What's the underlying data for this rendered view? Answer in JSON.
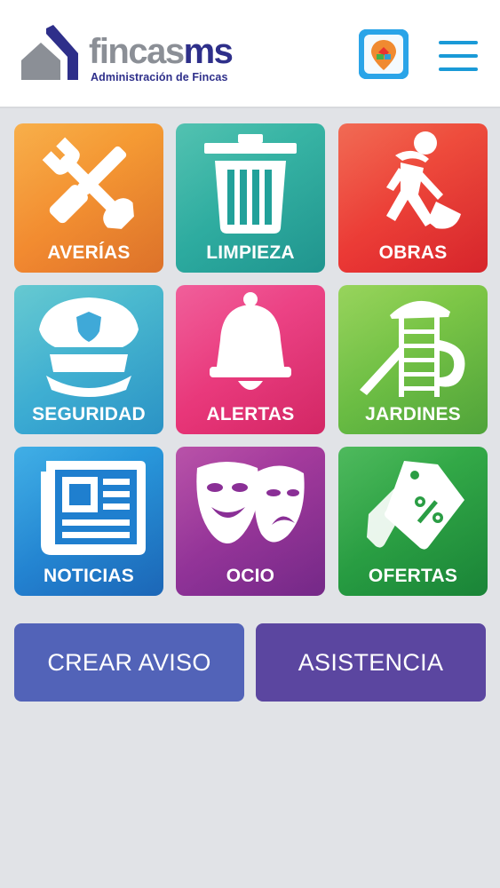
{
  "header": {
    "brand_part1": "fincas",
    "brand_part2": "ms",
    "tagline": "Administración de Fincas"
  },
  "tiles": [
    {
      "label": "AVERÍAS",
      "icon": "tools-icon",
      "color_from": "#f7a636",
      "color_to": "#ef7b2d"
    },
    {
      "label": "LIMPIEZA",
      "icon": "trash-icon",
      "color_from": "#3fbba8",
      "color_to": "#22a19a"
    },
    {
      "label": "OBRAS",
      "icon": "worker-shovel-icon",
      "color_from": "#f05a41",
      "color_to": "#e8282f"
    },
    {
      "label": "SEGURIDAD",
      "icon": "police-cap-icon",
      "color_from": "#55c3cc",
      "color_to": "#2e9fd6"
    },
    {
      "label": "ALERTAS",
      "icon": "bell-icon",
      "color_from": "#ef4d8f",
      "color_to": "#e42a6d"
    },
    {
      "label": "JARDINES",
      "icon": "playground-icon",
      "color_from": "#8ccf4a",
      "color_to": "#56b13f"
    },
    {
      "label": "NOTICIAS",
      "icon": "newspaper-icon",
      "color_from": "#2ca6e3",
      "color_to": "#1e6fc6"
    },
    {
      "label": "OCIO",
      "icon": "theater-masks-icon",
      "color_from": "#b13f9f",
      "color_to": "#7e2c93"
    },
    {
      "label": "OFERTAS",
      "icon": "price-tag-icon",
      "color_from": "#3bb24b",
      "color_to": "#1c8f3c"
    }
  ],
  "buttons": {
    "create_label": "CREAR AVISO",
    "create_color": "#5263b8",
    "assist_label": "ASISTENCIA",
    "assist_color": "#5b46a0"
  }
}
